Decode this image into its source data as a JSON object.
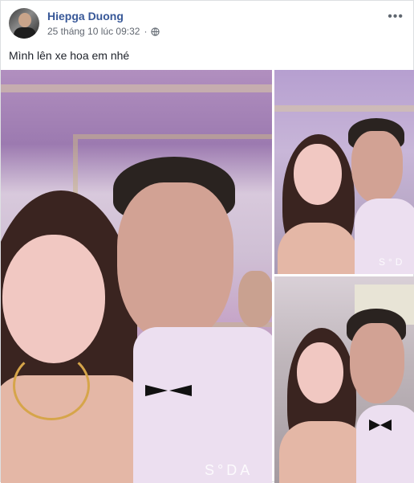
{
  "post": {
    "author": "Hiepga Duong",
    "timestamp": "25 tháng 10 lúc 09:32",
    "privacy_icon": "globe-icon",
    "more_icon": "more-options-icon",
    "more_label": "•••",
    "status_text": "Mình lên xe hoa em nhé"
  },
  "photos": [
    {
      "watermark": "S°DA"
    },
    {
      "watermark": "S°D"
    },
    {
      "watermark": ""
    }
  ],
  "colors": {
    "link": "#385898",
    "meta": "#616770",
    "text": "#1d2129"
  }
}
